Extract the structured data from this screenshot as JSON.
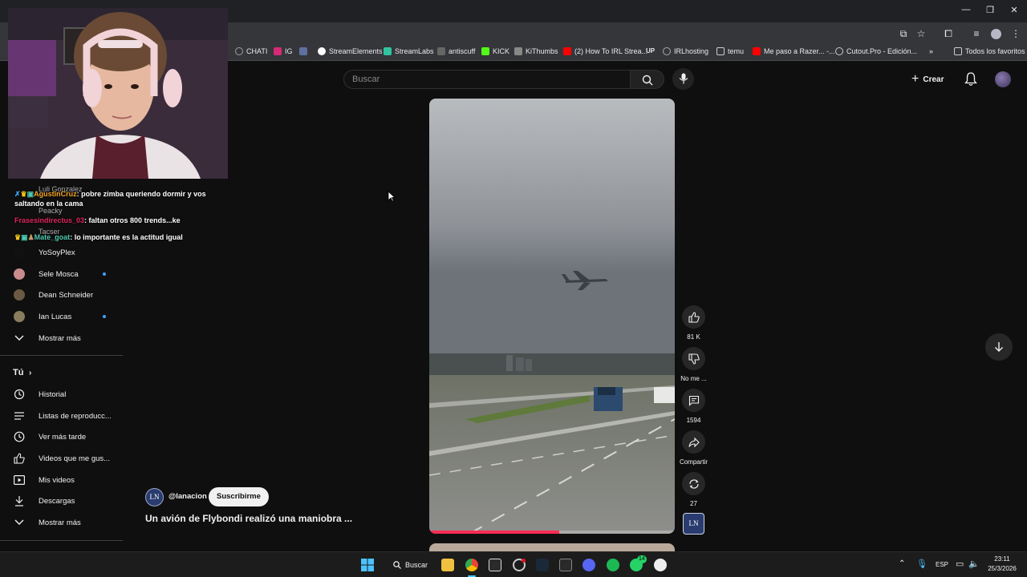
{
  "browser": {
    "window_controls": [
      "—",
      "❐",
      "✕"
    ],
    "bookmarks": [
      {
        "label": "CHATI",
        "color": "#9e9e9e"
      },
      {
        "label": "IG",
        "color": "#d62976"
      },
      {
        "label": "",
        "color": "#8ab4f8"
      },
      {
        "label": "StreamElements",
        "color": "#ffffff"
      },
      {
        "label": "StreamLabs",
        "color": "#31c3a2"
      },
      {
        "label": "antiscuff",
        "color": "#9e9e9e"
      },
      {
        "label": "KICK",
        "color": "#53fc18"
      },
      {
        "label": "KiThumbs",
        "color": "#9e9e9e"
      },
      {
        "label": "(2) How To IRL Strea...",
        "color": "#ff0000"
      },
      {
        "label": "IRLhosting",
        "color": "#9e9e9e"
      },
      {
        "label": "temu",
        "color": "#9e9e9e"
      },
      {
        "label": "Me paso a Razer... -...",
        "color": "#ff0000"
      },
      {
        "label": "Cutout.Pro - Edición...",
        "color": "#9e9e9e"
      }
    ],
    "bookmarks_more": "»",
    "all_bookmarks": "Todos los favoritos"
  },
  "header": {
    "search_placeholder": "Buscar",
    "create_label": "Crear"
  },
  "stream_overlay": {
    "chat": [
      {
        "user": "AgustinCruz",
        "user_color": "#f5a623",
        "text": "pobre zimba queriendo dormir y vos saltando en la cama"
      },
      {
        "user": "Frasesindirectus_03",
        "user_color": "#e0245e",
        "text": "faltan otros 800 trends...ke"
      },
      {
        "user": "Mate_goat",
        "user_color": "#4ec9b0",
        "text": "lo importante es la actitud igual"
      }
    ],
    "hidden_names": [
      "Luli Gonzalez",
      "Peacky",
      "Tacser"
    ]
  },
  "sidebar": {
    "subscriptions": [
      {
        "label": "YoSoyPlex",
        "live": false,
        "color": "#111111"
      },
      {
        "label": "Sele Mosca",
        "live": true,
        "color": "#c98b8b"
      },
      {
        "label": "Dean Schneider",
        "live": false,
        "color": "#6b5a43"
      },
      {
        "label": "Ian Lucas",
        "live": true,
        "color": "#8a7d5c"
      }
    ],
    "show_more_1": "Mostrar más",
    "you_label": "Tú",
    "you_items": [
      {
        "label": "Historial",
        "icon": "history-icon"
      },
      {
        "label": "Listas de reproducc...",
        "icon": "playlist-icon"
      },
      {
        "label": "Ver más tarde",
        "icon": "clock-icon"
      },
      {
        "label": "Videos que me gus...",
        "icon": "thumbs-up-icon"
      },
      {
        "label": "Mis videos",
        "icon": "my-videos-icon"
      },
      {
        "label": "Descargas",
        "icon": "download-icon"
      }
    ],
    "show_more_2": "Mostrar más"
  },
  "short": {
    "channel": "@lanacion",
    "channel_avatar_text": "LN",
    "subscribe_label": "Suscribirme",
    "title": "Un avión de Flybondi realizó una maniobra ...",
    "progress": 0.53,
    "actions": {
      "likes": "81 K",
      "dislike": "No me ...",
      "comments": "1594",
      "share": "Compartir",
      "remix": "27"
    }
  },
  "taskbar": {
    "search_label": "Buscar",
    "lang": "ESP",
    "time": "23:11",
    "date": "25/3/2026",
    "whatsapp_badge": "14"
  }
}
